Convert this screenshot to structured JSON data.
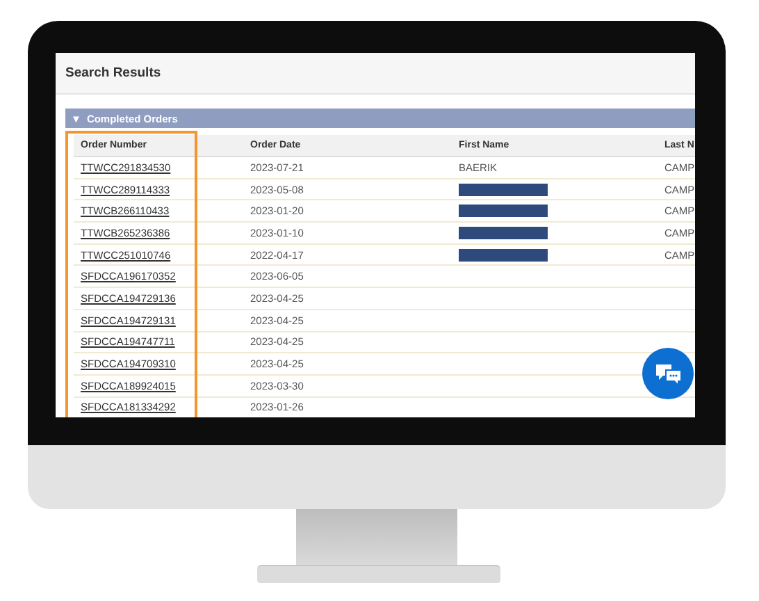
{
  "screen": {
    "title": "Search Results",
    "section": {
      "toggle": "▼",
      "title": "Completed Orders"
    },
    "table": {
      "columns": [
        "Order Number",
        "Order Date",
        "First Name",
        "Last N"
      ],
      "rows": [
        {
          "order_number": "TTWCC291834530",
          "order_date": "2023-07-21",
          "first_name": "BAERIK",
          "redacted": false,
          "last_name": "CAMP"
        },
        {
          "order_number": "TTWCC289114333",
          "order_date": "2023-05-08",
          "redacted": true,
          "last_name": "CAMP"
        },
        {
          "order_number": "TTWCB266110433",
          "order_date": "2023-01-20",
          "redacted": true,
          "last_name": "CAMP"
        },
        {
          "order_number": "TTWCB265236386",
          "order_date": "2023-01-10",
          "redacted": true,
          "last_name": "CAMP"
        },
        {
          "order_number": "TTWCC251010746",
          "order_date": "2022-04-17",
          "redacted": true,
          "last_name": "CAMP"
        },
        {
          "order_number": "SFDCCA196170352",
          "order_date": "2023-06-05",
          "redacted": false
        },
        {
          "order_number": "SFDCCA194729136",
          "order_date": "2023-04-25",
          "redacted": false
        },
        {
          "order_number": "SFDCCA194729131",
          "order_date": "2023-04-25",
          "redacted": false
        },
        {
          "order_number": "SFDCCA194747711",
          "order_date": "2023-04-25",
          "redacted": false
        },
        {
          "order_number": "SFDCCA194709310",
          "order_date": "2023-04-25",
          "redacted": false
        },
        {
          "order_number": "SFDCCA189924015",
          "order_date": "2023-03-30",
          "redacted": false
        },
        {
          "order_number": "SFDCCA181334292",
          "order_date": "2023-01-26",
          "redacted": false
        }
      ]
    }
  }
}
